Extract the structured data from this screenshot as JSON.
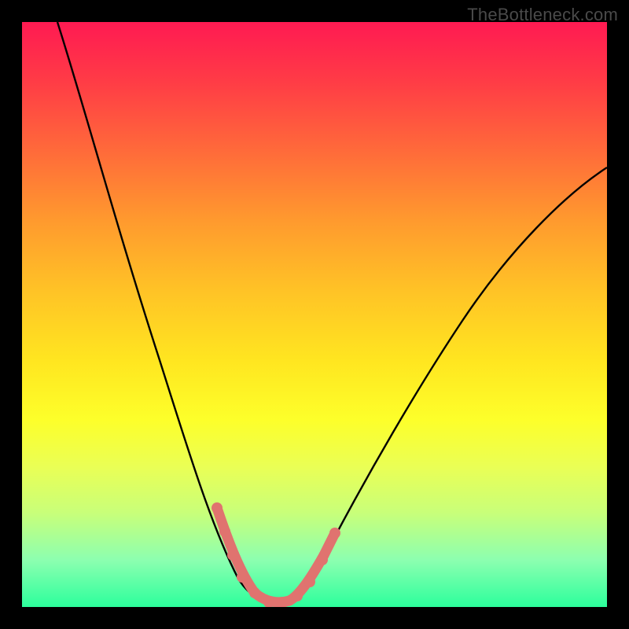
{
  "watermark": "TheBottleneck.com",
  "chart_data": {
    "type": "line",
    "title": "",
    "xlabel": "",
    "ylabel": "",
    "xlim": [
      0,
      100
    ],
    "ylim": [
      0,
      100
    ],
    "series": [
      {
        "name": "bottleneck-curve",
        "x": [
          6,
          10,
          14,
          18,
          22,
          26,
          30,
          33,
          35,
          37,
          39,
          41,
          43,
          45,
          48,
          52,
          56,
          60,
          66,
          74,
          82,
          90,
          100
        ],
        "y": [
          100,
          88,
          76,
          64,
          52,
          40,
          28,
          18,
          12,
          7,
          3,
          1,
          1,
          2,
          5,
          10,
          17,
          25,
          35,
          47,
          57,
          65,
          72
        ]
      },
      {
        "name": "highlight-band",
        "x": [
          33,
          34.5,
          36,
          37.5,
          39,
          41,
          43,
          44.5,
          46,
          47.5,
          49
        ],
        "y": [
          18,
          13,
          9,
          6,
          3,
          1,
          1.5,
          3,
          5.5,
          8.5,
          12
        ]
      }
    ],
    "annotations": [],
    "colors": {
      "curve": "#000000",
      "highlight": "#e0736f",
      "gradient_top": "#ff1a52",
      "gradient_bottom": "#2cff9c"
    }
  }
}
